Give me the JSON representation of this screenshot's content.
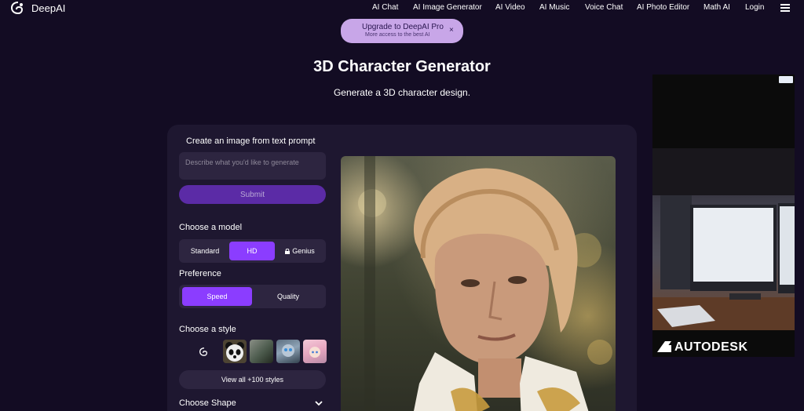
{
  "header": {
    "brand": "DeepAI",
    "nav": [
      {
        "label": "AI Chat",
        "name": "nav-ai-chat"
      },
      {
        "label": "AI Image Generator",
        "name": "nav-ai-image-generator"
      },
      {
        "label": "AI Video",
        "name": "nav-ai-video"
      },
      {
        "label": "AI Music",
        "name": "nav-ai-music"
      },
      {
        "label": "Voice Chat",
        "name": "nav-voice-chat"
      },
      {
        "label": "AI Photo Editor",
        "name": "nav-ai-photo-editor"
      },
      {
        "label": "Math AI",
        "name": "nav-math-ai"
      },
      {
        "label": "Login",
        "name": "nav-login"
      }
    ],
    "menu_icon": "hamburger-menu-icon"
  },
  "upgrade": {
    "title": "Upgrade to DeepAI Pro",
    "subtitle": "More access to the best AI",
    "close": "×"
  },
  "page": {
    "title": "3D Character Generator",
    "subtitle": "Generate a 3D character design."
  },
  "prompt": {
    "heading": "Create an image from text prompt",
    "placeholder": "Describe what you'd like to generate",
    "submit": "Submit"
  },
  "model": {
    "label": "Choose a model",
    "options": [
      "Standard",
      "HD",
      "Genius"
    ],
    "selected": "HD"
  },
  "preference": {
    "label": "Preference",
    "options": [
      "Speed",
      "Quality"
    ],
    "selected": "Speed"
  },
  "style": {
    "label": "Choose a style",
    "thumbs": [
      "deepai-logo-style",
      "panda-style",
      "forest-style",
      "robot-style",
      "anime-girl-style"
    ],
    "view_all": "View all +100 styles"
  },
  "shape": {
    "label": "Choose Shape"
  },
  "ad": {
    "brand": "AUTODESK"
  },
  "colors": {
    "background": "#130c23",
    "panel": "#1e1730",
    "accent": "#8b3dff",
    "submit": "#5b2ba6",
    "upgrade_pill": "#c8a6e8"
  }
}
